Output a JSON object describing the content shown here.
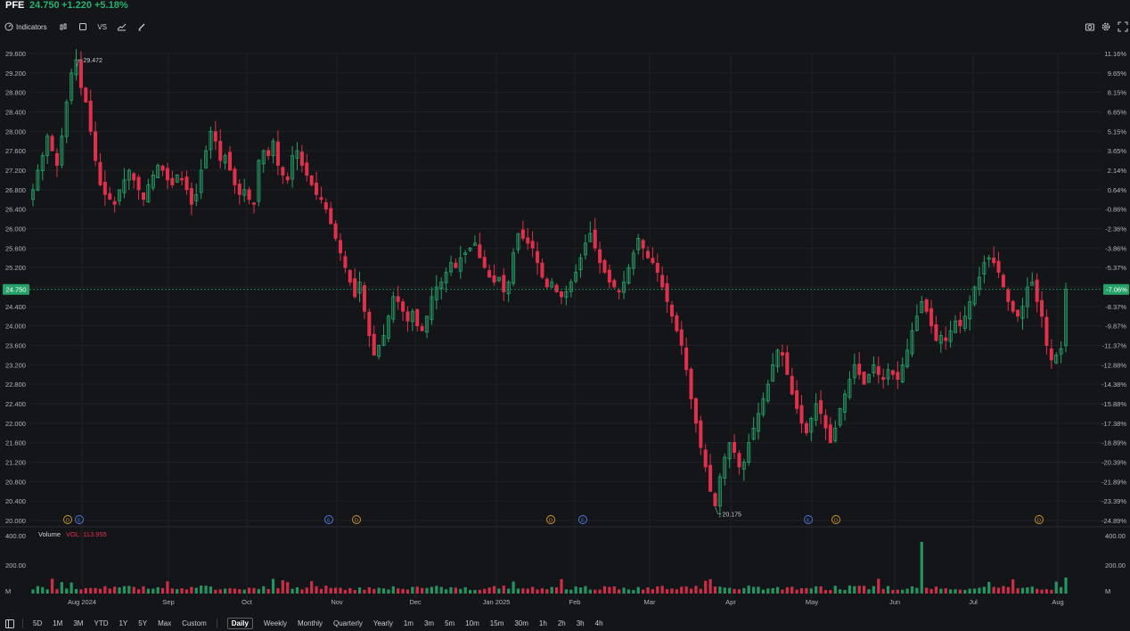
{
  "header": {
    "symbol": "PFE",
    "price": "24.750",
    "change": "+1.220",
    "change_pct": "+5.18%"
  },
  "toolbar": {
    "indicators_label": "Indicators",
    "vs_label": "VS",
    "left_icons": [
      "candlestick-type-icon",
      "square-icon",
      "compare-icon",
      "chart-line-icon",
      "pencil-icon"
    ],
    "right_icons": [
      "camera-icon",
      "gear-icon",
      "fullscreen-icon"
    ]
  },
  "colors": {
    "up": "#26a269",
    "down": "#e0314b",
    "bg": "#141518",
    "grid": "#1f2126",
    "axis_text": "#b2b5be",
    "price_badge": "#26a269",
    "events_d": "#d99a2b",
    "events_e": "#4f7fe8"
  },
  "chart_data": {
    "type": "candlestick",
    "y_ticks": [
      "29.600",
      "29.200",
      "28.800",
      "28.400",
      "28.000",
      "27.600",
      "27.200",
      "26.800",
      "26.400",
      "26.000",
      "25.600",
      "25.200",
      "24.800",
      "24.400",
      "24.000",
      "23.600",
      "23.200",
      "22.800",
      "22.400",
      "22.000",
      "21.600",
      "21.200",
      "20.800",
      "20.400",
      "20.000"
    ],
    "pct_ticks": [
      "11.16%",
      "9.65%",
      "8.15%",
      "6.65%",
      "5.15%",
      "3.65%",
      "2.14%",
      "0.64%",
      "-0.86%",
      "-2.36%",
      "-3.86%",
      "-5.37%",
      "-7.06%",
      "-8.37%",
      "-9.87%",
      "-11.37%",
      "-12.88%",
      "-14.38%",
      "-15.88%",
      "-17.38%",
      "-18.89%",
      "-20.39%",
      "-21.89%",
      "-23.39%",
      "-24.89%"
    ],
    "ylim": [
      20.0,
      29.6
    ],
    "x_labels": [
      "Aug 2024",
      "Sep",
      "Oct",
      "Nov",
      "Dec",
      "Jan 2025",
      "Feb",
      "Mar",
      "Apr",
      "May",
      "Jun",
      "Jul",
      "Aug"
    ],
    "current_price": "24.750",
    "current_pct": "-7.06%",
    "high_label": "29.472",
    "low_label": "20.175",
    "events": [
      "D",
      "E",
      "E",
      "D",
      "D",
      "E",
      "E",
      "D",
      "D"
    ],
    "closes": [
      26.8,
      27.2,
      27.5,
      27.9,
      27.6,
      27.3,
      27.9,
      28.6,
      29.2,
      29.47,
      28.9,
      28.6,
      28.0,
      27.4,
      26.9,
      26.7,
      26.6,
      26.5,
      26.8,
      27.0,
      27.2,
      27.0,
      26.8,
      26.6,
      26.9,
      27.1,
      27.3,
      27.2,
      27.0,
      26.9,
      27.1,
      27.0,
      26.8,
      26.5,
      26.7,
      27.2,
      27.6,
      28.0,
      27.8,
      27.4,
      27.5,
      27.2,
      26.9,
      26.7,
      26.8,
      26.6,
      26.5,
      27.4,
      27.6,
      27.5,
      27.8,
      27.3,
      27.1,
      27.0,
      27.5,
      27.6,
      27.3,
      27.1,
      26.9,
      26.7,
      26.6,
      26.4,
      26.1,
      25.8,
      25.5,
      25.2,
      24.9,
      24.6,
      24.9,
      24.3,
      23.8,
      23.4,
      23.6,
      23.8,
      24.2,
      24.6,
      24.5,
      24.3,
      24.1,
      24.3,
      24.0,
      23.9,
      24.2,
      24.6,
      24.8,
      24.9,
      25.1,
      25.3,
      25.2,
      25.4,
      25.5,
      25.6,
      25.7,
      25.4,
      25.2,
      25.0,
      24.9,
      25.0,
      24.7,
      24.9,
      25.5,
      25.9,
      25.8,
      25.7,
      25.6,
      25.3,
      25.0,
      24.8,
      24.9,
      24.7,
      24.6,
      24.7,
      24.9,
      25.1,
      25.4,
      25.7,
      25.9,
      25.6,
      25.3,
      25.1,
      24.9,
      24.8,
      24.7,
      24.9,
      25.2,
      25.5,
      25.8,
      25.6,
      25.4,
      25.3,
      25.1,
      24.8,
      24.5,
      24.2,
      23.9,
      23.6,
      23.1,
      22.5,
      22.0,
      21.5,
      21.1,
      20.6,
      20.3,
      20.9,
      21.3,
      21.6,
      21.4,
      21.1,
      21.2,
      21.6,
      21.9,
      22.2,
      22.5,
      22.8,
      23.2,
      23.5,
      23.4,
      23.0,
      22.6,
      22.3,
      22.0,
      21.8,
      22.1,
      22.4,
      22.2,
      21.9,
      21.6,
      21.9,
      22.3,
      22.6,
      22.9,
      23.2,
      23.0,
      22.8,
      23.0,
      23.2,
      23.0,
      22.9,
      23.1,
      23.0,
      22.9,
      23.2,
      23.5,
      23.9,
      24.2,
      24.5,
      24.3,
      24.0,
      23.7,
      23.8,
      23.7,
      23.9,
      24.1,
      24.0,
      24.2,
      24.5,
      24.8,
      25.0,
      25.3,
      25.4,
      25.3,
      25.1,
      24.8,
      24.5,
      24.3,
      24.2,
      24.4,
      24.8,
      24.9,
      24.5,
      24.2,
      23.6,
      23.3,
      23.4,
      23.53,
      24.75
    ],
    "volume_label": "Volume",
    "vol_value": "VOL: 113.955",
    "vol_ticks": [
      "400.00",
      "200.00",
      "M"
    ],
    "vol_spike_index": 185,
    "vol_last": "113.955"
  },
  "bottom": {
    "ranges": [
      "5D",
      "1M",
      "3M",
      "YTD",
      "1Y",
      "5Y",
      "Max",
      "Custom"
    ],
    "intervals": [
      "Daily",
      "Weekly",
      "Monthly",
      "Quarterly",
      "Yearly",
      "1m",
      "3m",
      "5m",
      "10m",
      "15m",
      "30m",
      "1h",
      "2h",
      "3h",
      "4h"
    ],
    "active": "Daily"
  }
}
